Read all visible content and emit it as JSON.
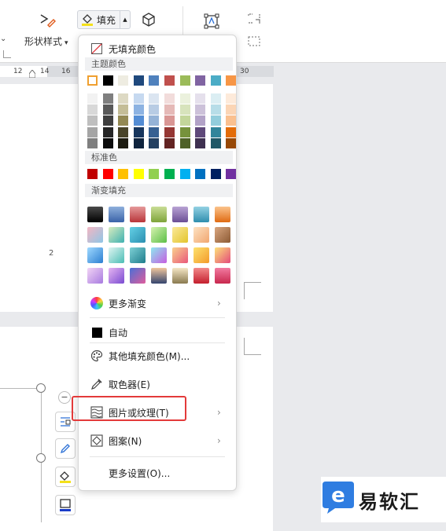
{
  "ribbon": {
    "shape_style_label": "形状样式",
    "fill_label": "填充"
  },
  "ruler": {
    "ticks": [
      "12",
      "14",
      "16",
      "30"
    ]
  },
  "page": {
    "page_number": "2"
  },
  "fill_menu": {
    "no_fill": "无填充颜色",
    "theme_colors_header": "主题颜色",
    "theme_colors_top": [
      "#ffffff",
      "#000000",
      "#eeece1",
      "#1f497d",
      "#4f81bd",
      "#c0504d",
      "#9bbb59",
      "#8064a2",
      "#4bacc6",
      "#f79646"
    ],
    "theme_colors_shades": [
      [
        "#f2f2f2",
        "#7f7f7f",
        "#ddd9c3",
        "#c6d9f0",
        "#dbe5f1",
        "#f2dcdb",
        "#ebf1dd",
        "#e5e0ec",
        "#dbeef3",
        "#fdeada"
      ],
      [
        "#d8d8d8",
        "#595959",
        "#c4bd97",
        "#8db3e2",
        "#b8cce4",
        "#e5b9b7",
        "#d7e3bc",
        "#ccc1d9",
        "#b7dde8",
        "#fbd5b5"
      ],
      [
        "#bfbfbf",
        "#3f3f3f",
        "#938953",
        "#548dd4",
        "#95b3d7",
        "#d99694",
        "#c3d69b",
        "#b2a2c7",
        "#92cddc",
        "#fac08f"
      ],
      [
        "#a5a5a5",
        "#262626",
        "#494429",
        "#17365d",
        "#366092",
        "#953734",
        "#76923c",
        "#5f497a",
        "#31859b",
        "#e36c09"
      ],
      [
        "#7f7f7f",
        "#0c0c0c",
        "#1d1b10",
        "#0f243e",
        "#244061",
        "#632423",
        "#4f6128",
        "#3f3151",
        "#205867",
        "#974806"
      ]
    ],
    "standard_colors_header": "标准色",
    "standard_colors": [
      "#c00000",
      "#ff0000",
      "#ffc000",
      "#ffff00",
      "#92d050",
      "#00b050",
      "#00b0f0",
      "#0070c0",
      "#002060",
      "#7030a0"
    ],
    "gradient_header": "渐变填充",
    "gradients": [
      [
        "linear-gradient(180deg,#4a4a4a,#000000)",
        "linear-gradient(180deg,#8fb0dc,#3a63a8)",
        "linear-gradient(180deg,#e59a9a,#b8363a)",
        "linear-gradient(180deg,#c9dd96,#7ea43a)",
        "linear-gradient(180deg,#b9a3d4,#6a4f95)",
        "linear-gradient(180deg,#94d1e3,#2f8eae)",
        "linear-gradient(180deg,#fbc38b,#e06b13)"
      ],
      [
        "linear-gradient(135deg,#f4b6c2,#8fc6e6)",
        "linear-gradient(135deg,#d8ecc0,#3fb1b1)",
        "linear-gradient(135deg,#63d0e6,#2b8fb0)",
        "linear-gradient(135deg,#d6f2b0,#5cbf47)",
        "linear-gradient(135deg,#fbe99a,#e3c52d)",
        "linear-gradient(135deg,#fde2c2,#f1a670)",
        "linear-gradient(135deg,#d9a680,#8c5a34)"
      ],
      [
        "linear-gradient(135deg,#9fd9ff,#2c7fd1)",
        "linear-gradient(135deg,#e0f5f2,#4bbdb5)",
        "linear-gradient(135deg,#7dd0d5,#1f7d8c)",
        "linear-gradient(135deg,#8de8f0,#c65de0)",
        "linear-gradient(135deg,#f9d08d,#e9577a)",
        "linear-gradient(135deg,#fde26e,#f39a2a)",
        "linear-gradient(135deg,#fde27a,#e44a7a)"
      ],
      [
        "linear-gradient(135deg,#f2d4f5,#a87be0)",
        "linear-gradient(135deg,#e7b6f2,#7a4bd1)",
        "linear-gradient(135deg,#4a6fd6,#e05d9c)",
        "linear-gradient(180deg,#f1c69c,#35456e)",
        "linear-gradient(180deg,#f5e7c6,#8a7a4f)",
        "linear-gradient(180deg,#f28a8a,#c41f2e)",
        "linear-gradient(180deg,#f27aa0,#c8284e)"
      ]
    ],
    "more_gradients": "更多渐变",
    "auto": "自动",
    "other_colors": "其他填充颜色(M)...",
    "eyedropper": "取色器(E)",
    "picture_texture": "图片或纹理(T)",
    "pattern": "图案(N)",
    "more_settings": "更多设置(O)..."
  },
  "watermark": {
    "text": "易软汇"
  }
}
